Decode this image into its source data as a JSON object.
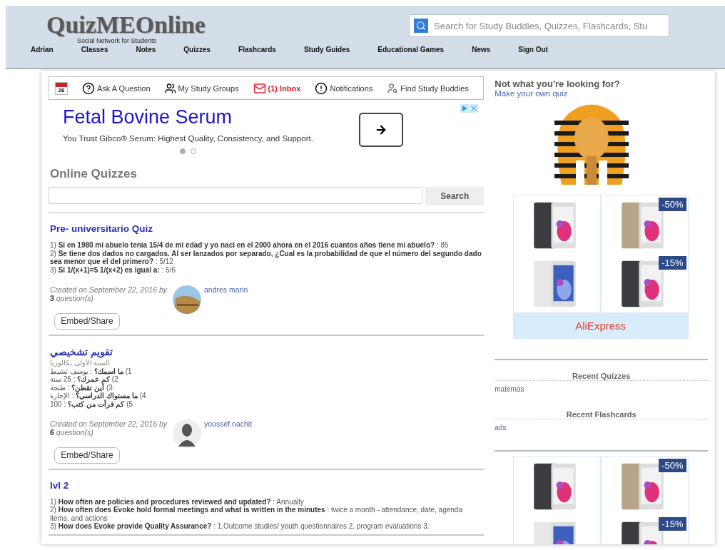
{
  "header": {
    "logo": "QuizMEOnline",
    "tagline": "Social Network for Students",
    "search": {
      "placeholder": "Search for Study Buddies, Quizzes, Flashcards, Stu"
    }
  },
  "nav": [
    "Adrian",
    "Classes",
    "Notes",
    "Quizzes",
    "Flashcards",
    "Study Guides",
    "Educational Games",
    "News",
    "Sign Out"
  ],
  "toolbar": {
    "calendar_day": "26",
    "items": [
      {
        "kind": "question",
        "label": "Ask A Question",
        "unread": false
      },
      {
        "kind": "groups",
        "label": "My Study Groups",
        "unread": false
      },
      {
        "kind": "inbox",
        "label": "(1) Inbox",
        "unread": true
      },
      {
        "kind": "alert",
        "label": "Notifications",
        "unread": false
      },
      {
        "kind": "buddies",
        "label": "Find Study Buddies",
        "unread": false
      }
    ]
  },
  "ad": {
    "headline": "Fetal Bovine Serum",
    "text": "You Trust Gibco® Serum: Highest Quality, Consistency, and Support.",
    "dots": [
      {
        "selected": true
      },
      {
        "selected": false
      }
    ]
  },
  "quiz_search": {
    "title": "Online Quizzes",
    "button": "Search"
  },
  "quizzes": [
    {
      "title": "Pre- universitario Quiz",
      "lines": [
        "1) **Si en 1980 mi abuelo tenia 15/4 de mi edad y yo naci en el 2000 ahora en el 2016 cuantos años tiene mi abuelo?** : 85",
        "2) **Se tiene dos dados no cargados. Al ser lanzados por separado, ¿Cual es la probabilidad de que el número del segundo dado sea menor que el del primero?** : 5/12",
        "3) **Si 1/(x+1)=5 1/(x+2) es igual a:** : 5/6"
      ],
      "created": "Created on September 22, 2016 by",
      "count": "**3** question(s)",
      "author": "andres marin",
      "avatar": {
        "kind": "picture"
      },
      "button": "Embed/Share"
    },
    {
      "title": "تقويم تشخيصي",
      "subtitle": "السنة الأولى بكالوريا",
      "lines": [
        "1) **ما اسمك؟** : يوسف نشيط",
        "2) **كم عمرك؟** : 25 سنة",
        "3) **أين تقطن؟** : طنجة",
        "4) **ما مستواك الدراسي؟** : الإجازة",
        "5) **كم قرأت من كتب؟** : 100"
      ],
      "created": "Created on September 22, 2016 by",
      "count": "**6** question(s)",
      "author": "youssef nachit",
      "avatar": {
        "kind": "silhouette"
      },
      "button": "Embed/Share"
    },
    {
      "title": "lvl 2",
      "lines": [
        "1) **How often are policies and procedures reviewed and updated?** : Annually",
        "2) **How often does Evoke hold formal meetings and what is written in the minutes** : twice a month - attendance, date, agenda items, and actions",
        "3) **How does Evoke provide Quality Assurance?** : 1.Outcome studies/ youth questionnaires 2. program evaluations 3."
      ]
    }
  ],
  "sidebar": {
    "prompt": "Not what you're looking for?",
    "link": "Make your own quiz",
    "ads": [
      {
        "cells": [
          {
            "kind": "picture"
          },
          {
            "kind": "picture",
            "badge": "-50%"
          },
          {
            "kind": "picture"
          },
          {
            "kind": "picture",
            "badge": "-15%"
          }
        ],
        "brand": "AliExpress"
      },
      {
        "cells": [
          {
            "kind": "picture"
          },
          {
            "kind": "picture",
            "badge": "-50%"
          },
          {
            "kind": "picture"
          },
          {
            "kind": "picture",
            "badge": "-15%"
          }
        ]
      }
    ],
    "recent": [
      {
        "title": "Recent Quizzes",
        "items": [
          "matemas"
        ]
      },
      {
        "title": "Recent Flashcards",
        "items": [
          "ads"
        ]
      }
    ]
  }
}
